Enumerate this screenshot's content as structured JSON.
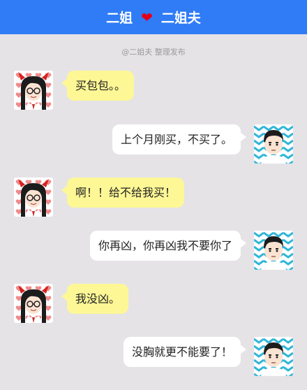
{
  "header": {
    "left_name": "二姐",
    "heart_icon": "❤",
    "right_name": "二姐夫",
    "background": "#2f7cf6",
    "heart_color": "#e4001b"
  },
  "credit": "@二姐夫 整理发布",
  "messages": [
    {
      "sender": "二姐",
      "side": "left",
      "text": "买包包。。",
      "avatar": "girl-devil-horns-avatar"
    },
    {
      "sender": "二姐夫",
      "side": "right",
      "text": "上个月刚买，不买了。",
      "avatar": "boy-avatar"
    },
    {
      "sender": "二姐",
      "side": "left",
      "text": "啊！！给不给我买！",
      "avatar": "girl-devil-horns-avatar"
    },
    {
      "sender": "二姐夫",
      "side": "right",
      "text": "你再凶，你再凶我不要你了",
      "avatar": "boy-avatar"
    },
    {
      "sender": "二姐",
      "side": "left",
      "text": "我没凶。",
      "avatar": "girl-devil-horns-avatar"
    },
    {
      "sender": "二姐夫",
      "side": "right",
      "text": "没胸就更不能要了！",
      "avatar": "boy-avatar"
    }
  ],
  "colors": {
    "left_bubble": "#fdf796",
    "right_bubble": "#ffffff",
    "chat_background": "#e5e3e6"
  }
}
